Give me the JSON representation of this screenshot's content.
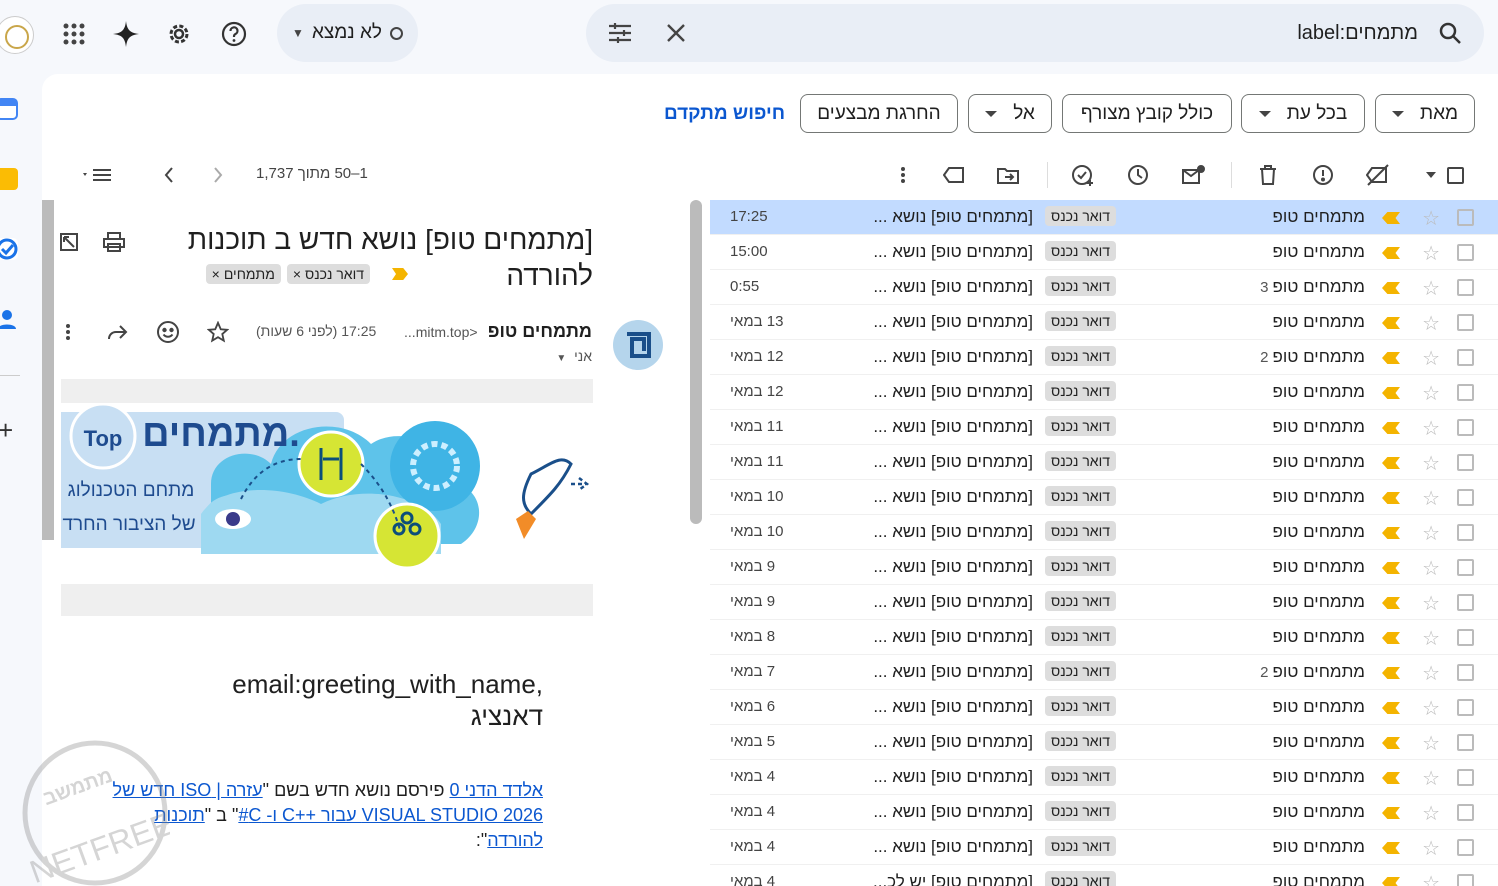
{
  "topbar": {
    "status": "לא נמצא",
    "search_query": "label:מתמחים"
  },
  "filters": {
    "from": "מאת",
    "any_time": "בכל עת",
    "has_attachment": "כולל קובץ מצורף",
    "to": "אל",
    "exclude_promotions": "החרגת מבצעים",
    "advanced_search": "חיפוש מתקדם"
  },
  "pager": {
    "range": "1–50 מתוך 1,737"
  },
  "message": {
    "subject": "[מתמחים טופ] נושא חדש ב תוכנות להורדה",
    "labels": [
      "דואר נכנס",
      "מתמחים"
    ],
    "sender": "מתמחים טופ",
    "address": "<mitm.top...",
    "to": "אני",
    "time": "17:25 (לפני 6 שעות)",
    "greeting_line1": "email:greeting_with_name,",
    "greeting_line2": "דאנציג",
    "body": {
      "link_user": "אלדד הדני 0",
      "text1": " פירסם נושא חדש בשם \"",
      "link_topic": "עזרה | ISO חדש של VISUAL STUDIO 2026 עבור ++C ו- C#",
      "text2": "\" ב \"",
      "link_forum": "תוכנות להורדה",
      "text3": "\":"
    },
    "banner_title": "מתמחים.",
    "banner_top": "Top",
    "banner_line1": "מתחם הטכנולוג",
    "banner_line2": "של הציבור החרד"
  },
  "watermark": {
    "brand": "מתמשב",
    "name": "NETFREE"
  },
  "colors": {
    "accent": "#0b57d0",
    "important": "#f4b400",
    "selected_row": "#c2dbff"
  },
  "emails": [
    {
      "from": "מתמחים טופ",
      "count": "",
      "label": "דואר נכנס",
      "subject": "[מתמחים טופ] נושא ...",
      "date": "17:25",
      "selected": true
    },
    {
      "from": "מתמחים טופ",
      "count": "",
      "label": "דואר נכנס",
      "subject": "[מתמחים טופ] נושא ...",
      "date": "15:00"
    },
    {
      "from": "מתמחים טופ",
      "count": "3",
      "label": "דואר נכנס",
      "subject": "[מתמחים טופ] נושא ...",
      "date": "0:55"
    },
    {
      "from": "מתמחים טופ",
      "count": "",
      "label": "דואר נכנס",
      "subject": "[מתמחים טופ] נושא ...",
      "date": "13 במאי"
    },
    {
      "from": "מתמחים טופ",
      "count": "2",
      "label": "דואר נכנס",
      "subject": "[מתמחים טופ] נושא ...",
      "date": "12 במאי"
    },
    {
      "from": "מתמחים טופ",
      "count": "",
      "label": "דואר נכנס",
      "subject": "[מתמחים טופ] נושא ...",
      "date": "12 במאי"
    },
    {
      "from": "מתמחים טופ",
      "count": "",
      "label": "דואר נכנס",
      "subject": "[מתמחים טופ] נושא ...",
      "date": "11 במאי"
    },
    {
      "from": "מתמחים טופ",
      "count": "",
      "label": "דואר נכנס",
      "subject": "[מתמחים טופ] נושא ...",
      "date": "11 במאי"
    },
    {
      "from": "מתמחים טופ",
      "count": "",
      "label": "דואר נכנס",
      "subject": "[מתמחים טופ] נושא ...",
      "date": "10 במאי"
    },
    {
      "from": "מתמחים טופ",
      "count": "",
      "label": "דואר נכנס",
      "subject": "[מתמחים טופ] נושא ...",
      "date": "10 במאי"
    },
    {
      "from": "מתמחים טופ",
      "count": "",
      "label": "דואר נכנס",
      "subject": "[מתמחים טופ] נושא ...",
      "date": "9 במאי"
    },
    {
      "from": "מתמחים טופ",
      "count": "",
      "label": "דואר נכנס",
      "subject": "[מתמחים טופ] נושא ...",
      "date": "9 במאי"
    },
    {
      "from": "מתמחים טופ",
      "count": "",
      "label": "דואר נכנס",
      "subject": "[מתמחים טופ] נושא ...",
      "date": "8 במאי"
    },
    {
      "from": "מתמחים טופ",
      "count": "2",
      "label": "דואר נכנס",
      "subject": "[מתמחים טופ] נושא ...",
      "date": "7 במאי"
    },
    {
      "from": "מתמחים טופ",
      "count": "",
      "label": "דואר נכנס",
      "subject": "[מתמחים טופ] נושא ...",
      "date": "6 במאי"
    },
    {
      "from": "מתמחים טופ",
      "count": "",
      "label": "דואר נכנס",
      "subject": "[מתמחים טופ] נושא ...",
      "date": "5 במאי"
    },
    {
      "from": "מתמחים טופ",
      "count": "",
      "label": "דואר נכנס",
      "subject": "[מתמחים טופ] נושא ...",
      "date": "4 במאי"
    },
    {
      "from": "מתמחים טופ",
      "count": "",
      "label": "דואר נכנס",
      "subject": "[מתמחים טופ] נושא ...",
      "date": "4 במאי"
    },
    {
      "from": "מתמחים טופ",
      "count": "",
      "label": "דואר נכנס",
      "subject": "[מתמחים טופ] נושא ...",
      "date": "4 במאי"
    },
    {
      "from": "מתמחים טופ",
      "count": "",
      "label": "דואר נכנס",
      "subject": "[מתמחים טופ] יש לכ...",
      "date": "4 במאי"
    }
  ]
}
